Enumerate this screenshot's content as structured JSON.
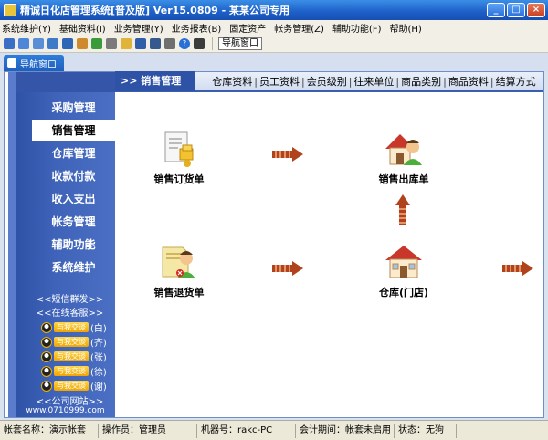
{
  "window": {
    "title": "精诚日化店管理系统[普及版] Ver15.0809 - 某某公司专用",
    "buttons": [
      "_",
      "□",
      "×"
    ]
  },
  "menu": [
    "系统维护(Y)",
    "基础资料(I)",
    "业务管理(Y)",
    "业务报表(B)",
    "固定资产",
    "帐务管理(Z)",
    "辅助功能(F)",
    "帮助(H)"
  ],
  "toolbar": {
    "icons": [
      "exit-icon",
      "open-icon",
      "window-icon",
      "calendar-icon",
      "monitor-icon",
      "network-icon",
      "users-icon",
      "tools-icon",
      "folder-icon",
      "save-icon",
      "backup-icon",
      "print-icon",
      "help-icon",
      "restore-icon"
    ],
    "nav_button": "导航窗口"
  },
  "tab": {
    "label": "导航窗口"
  },
  "header": {
    "title": ">> 销售管理",
    "links": [
      "仓库资料",
      "员工资料",
      "会员级别",
      "往来单位",
      "商品类别",
      "商品资料",
      "结算方式"
    ]
  },
  "sidebar": {
    "items": [
      "采购管理",
      "销售管理",
      "仓库管理",
      "收款付款",
      "收入支出",
      "帐务管理",
      "辅助功能",
      "系统维护"
    ],
    "active": "销售管理",
    "sms": "<<短信群发>>",
    "online": "<<在线客服>>",
    "support": [
      {
        "chat": "与我交谈",
        "who": "(白)"
      },
      {
        "chat": "与我交谈",
        "who": "(齐)"
      },
      {
        "chat": "与我交谈",
        "who": "(张)"
      },
      {
        "chat": "与我交谈",
        "who": "(徐)"
      },
      {
        "chat": "与我交谈",
        "who": "(谢)"
      }
    ],
    "website": "<<公司网站>>",
    "url": "www.0710999.com"
  },
  "flow": {
    "sales_order": "销售订货单",
    "sales_out": "销售出库单",
    "sales_return": "销售退货单",
    "warehouse": "仓库(门店)"
  },
  "status": {
    "account": "帐套名称：演示帐套",
    "operator": "操作员：管理员",
    "machine": "机器号：rakc-PC",
    "period": "会计期间：帐套未启用",
    "state": "状态：无狗"
  },
  "colors": {
    "accent": "#2e52a6",
    "arrow": "#b0431c",
    "titlebar": "#1d5fc8"
  }
}
